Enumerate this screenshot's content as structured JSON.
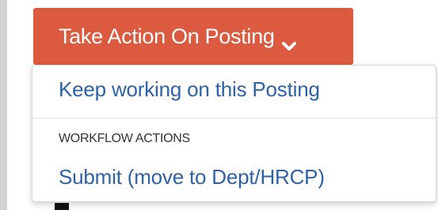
{
  "colors": {
    "button_bg": "#dc5a3f",
    "button_text": "#ffffff",
    "link_text": "#2d62a9",
    "header_text": "#333333"
  },
  "action_button": {
    "label": "Take Action On Posting",
    "icon": "chevron-down-icon"
  },
  "menu": {
    "items": [
      {
        "label": "Keep working on this Posting"
      }
    ],
    "workflow_section": {
      "header": "WORKFLOW ACTIONS",
      "items": [
        {
          "label": "Submit (move to Dept/HRCP)"
        }
      ]
    }
  }
}
